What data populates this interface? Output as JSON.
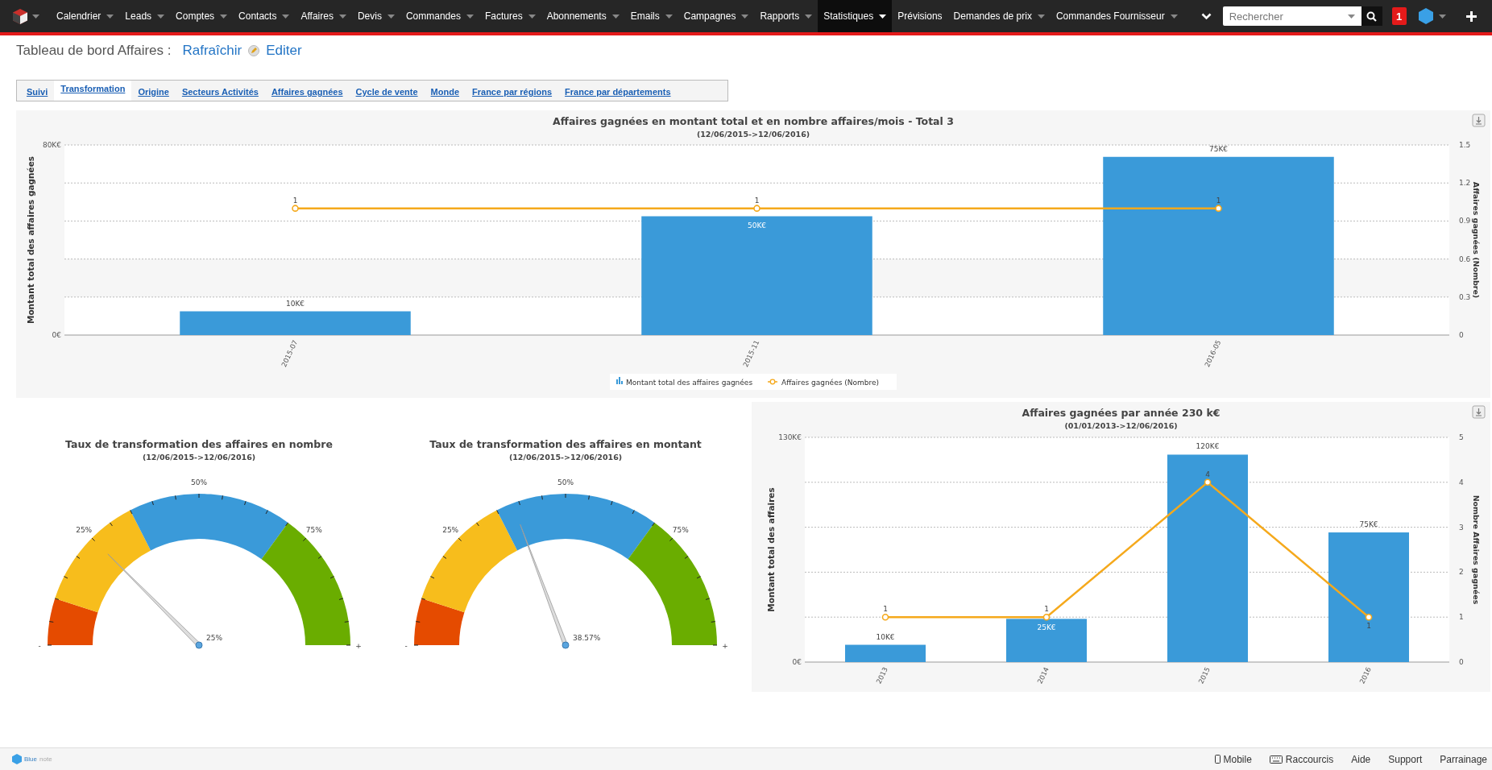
{
  "nav": {
    "items": [
      {
        "label": "Calendrier",
        "selected": false,
        "dropdown": true
      },
      {
        "label": "Leads",
        "selected": false,
        "dropdown": true
      },
      {
        "label": "Comptes",
        "selected": false,
        "dropdown": true
      },
      {
        "label": "Contacts",
        "selected": false,
        "dropdown": true
      },
      {
        "label": "Affaires",
        "selected": false,
        "dropdown": true
      },
      {
        "label": "Devis",
        "selected": false,
        "dropdown": true
      },
      {
        "label": "Commandes",
        "selected": false,
        "dropdown": true
      },
      {
        "label": "Factures",
        "selected": false,
        "dropdown": true
      },
      {
        "label": "Abonnements",
        "selected": false,
        "dropdown": true
      },
      {
        "label": "Emails",
        "selected": false,
        "dropdown": true
      },
      {
        "label": "Campagnes",
        "selected": false,
        "dropdown": true
      },
      {
        "label": "Rapports",
        "selected": false,
        "dropdown": true
      },
      {
        "label": "Statistiques",
        "selected": true,
        "dropdown": true
      },
      {
        "label": "Prévisions",
        "selected": false,
        "dropdown": false
      },
      {
        "label": "Demandes de prix",
        "selected": false,
        "dropdown": true
      },
      {
        "label": "Commandes Fournisseur",
        "selected": false,
        "dropdown": true
      }
    ],
    "search": {
      "placeholder": "Rechercher"
    },
    "notifications": "1"
  },
  "header": {
    "title": "Tableau de bord Affaires :",
    "refresh": "Rafraîchir",
    "edit": "Editer"
  },
  "tabs": [
    {
      "label": "Suivi",
      "selected": false
    },
    {
      "label": "Transformation",
      "selected": true
    },
    {
      "label": "Origine",
      "selected": false
    },
    {
      "label": "Secteurs Activités",
      "selected": false
    },
    {
      "label": "Affaires gagnées",
      "selected": false
    },
    {
      "label": "Cycle de vente",
      "selected": false
    },
    {
      "label": "Monde",
      "selected": false
    },
    {
      "label": "France par régions",
      "selected": false
    },
    {
      "label": "France par départements",
      "selected": false
    }
  ],
  "monthly_chart": {
    "chart_data": {
      "type": "bar",
      "title": "Affaires gagnées en montant total et en nombre affaires/mois - Total 3",
      "subtitle": "(12/06/2015->12/06/2016)",
      "ylabel": "Montant total des affaires gagnées",
      "y2label": "Affaires gagnées (Nombre)",
      "categories": [
        "2015-07",
        "2015-11",
        "2016-05"
      ],
      "series": [
        {
          "name": "Montant total des affaires gagnées",
          "type": "bar",
          "color": "#3a9ad9",
          "values": [
            10,
            50,
            75
          ],
          "value_labels": [
            "10K€",
            "50K€",
            "75K€"
          ]
        },
        {
          "name": "Affaires gagnées (Nombre)",
          "type": "line",
          "axis": "y2",
          "marker": "circle",
          "color": "#f5a91c",
          "values": [
            1,
            1,
            1
          ],
          "value_labels": [
            "1",
            "1",
            "1"
          ]
        }
      ],
      "ylim": [
        0,
        80
      ],
      "y2lim": [
        0,
        1.5
      ],
      "grid": true,
      "yticks": [
        {
          "value": 0,
          "label": "0€"
        },
        {
          "value": 80,
          "label": "80K€"
        }
      ],
      "y2ticks": [
        {
          "value": 0,
          "label": "0"
        },
        {
          "value": 0.3,
          "label": "0.3"
        },
        {
          "value": 0.6,
          "label": "0.6"
        },
        {
          "value": 0.9,
          "label": "0.9"
        },
        {
          "value": 1.2,
          "label": "1.2"
        },
        {
          "value": 1.5,
          "label": "1.5"
        }
      ],
      "bands": [
        {
          "axis": "y2",
          "from": 0.3,
          "to": 0.6
        }
      ],
      "legend": true
    }
  },
  "gauges": [
    {
      "title": "Taux de transformation des affaires en nombre",
      "subtitle": "(12/06/2015->12/06/2016)",
      "level": 0.25,
      "value_label": "25%",
      "scale_labels": [
        "25%",
        "50%",
        "75%"
      ],
      "min_label": "-",
      "max_label": "+"
    },
    {
      "title": "Taux de transformation des affaires en montant",
      "subtitle": "(12/06/2015->12/06/2016)",
      "level": 0.3857,
      "value_label": "38.57%",
      "scale_labels": [
        "25%",
        "50%",
        "75%"
      ],
      "min_label": "-",
      "max_label": "+"
    }
  ],
  "yearly_chart": {
    "chart_data": {
      "type": "bar",
      "title": "Affaires gagnées par année 230 k€",
      "subtitle": "(01/01/2013->12/06/2016)",
      "ylabel": "Montant total des affaires",
      "y2label": "Nombre Affaires gagnées",
      "categories": [
        "2013",
        "2014",
        "2015",
        "2016"
      ],
      "series": [
        {
          "type": "bar",
          "color": "#3a9ad9",
          "values": [
            10,
            25,
            120,
            75
          ],
          "value_labels": [
            "10K€",
            "25K€",
            "120K€",
            "75K€"
          ]
        },
        {
          "type": "line",
          "axis": "y2",
          "marker": "circle",
          "color": "#f5a91c",
          "values": [
            1,
            1,
            4,
            1
          ],
          "value_labels": [
            "1",
            "1",
            "4",
            "1"
          ]
        }
      ],
      "ylim": [
        0,
        130
      ],
      "y2lim": [
        0,
        5
      ],
      "grid": true,
      "yticks": [
        {
          "value": 0,
          "label": "0€"
        },
        {
          "value": 130,
          "label": "130K€"
        }
      ],
      "y2ticks": [
        {
          "value": 0,
          "label": "0"
        },
        {
          "value": 1,
          "label": "1"
        },
        {
          "value": 2,
          "label": "2"
        },
        {
          "value": 3,
          "label": "3"
        },
        {
          "value": 4,
          "label": "4"
        },
        {
          "value": 5,
          "label": "5"
        }
      ],
      "legend": false
    }
  },
  "footer": {
    "brand": "Blue",
    "brand_suffix": "note",
    "links": [
      {
        "label": "Mobile",
        "kind": "mobile"
      },
      {
        "label": "Raccourcis",
        "kind": "keyboard"
      },
      {
        "label": "Aide",
        "kind": "text"
      },
      {
        "label": "Support",
        "kind": "text"
      },
      {
        "label": "Parrainage",
        "kind": "text"
      }
    ]
  }
}
